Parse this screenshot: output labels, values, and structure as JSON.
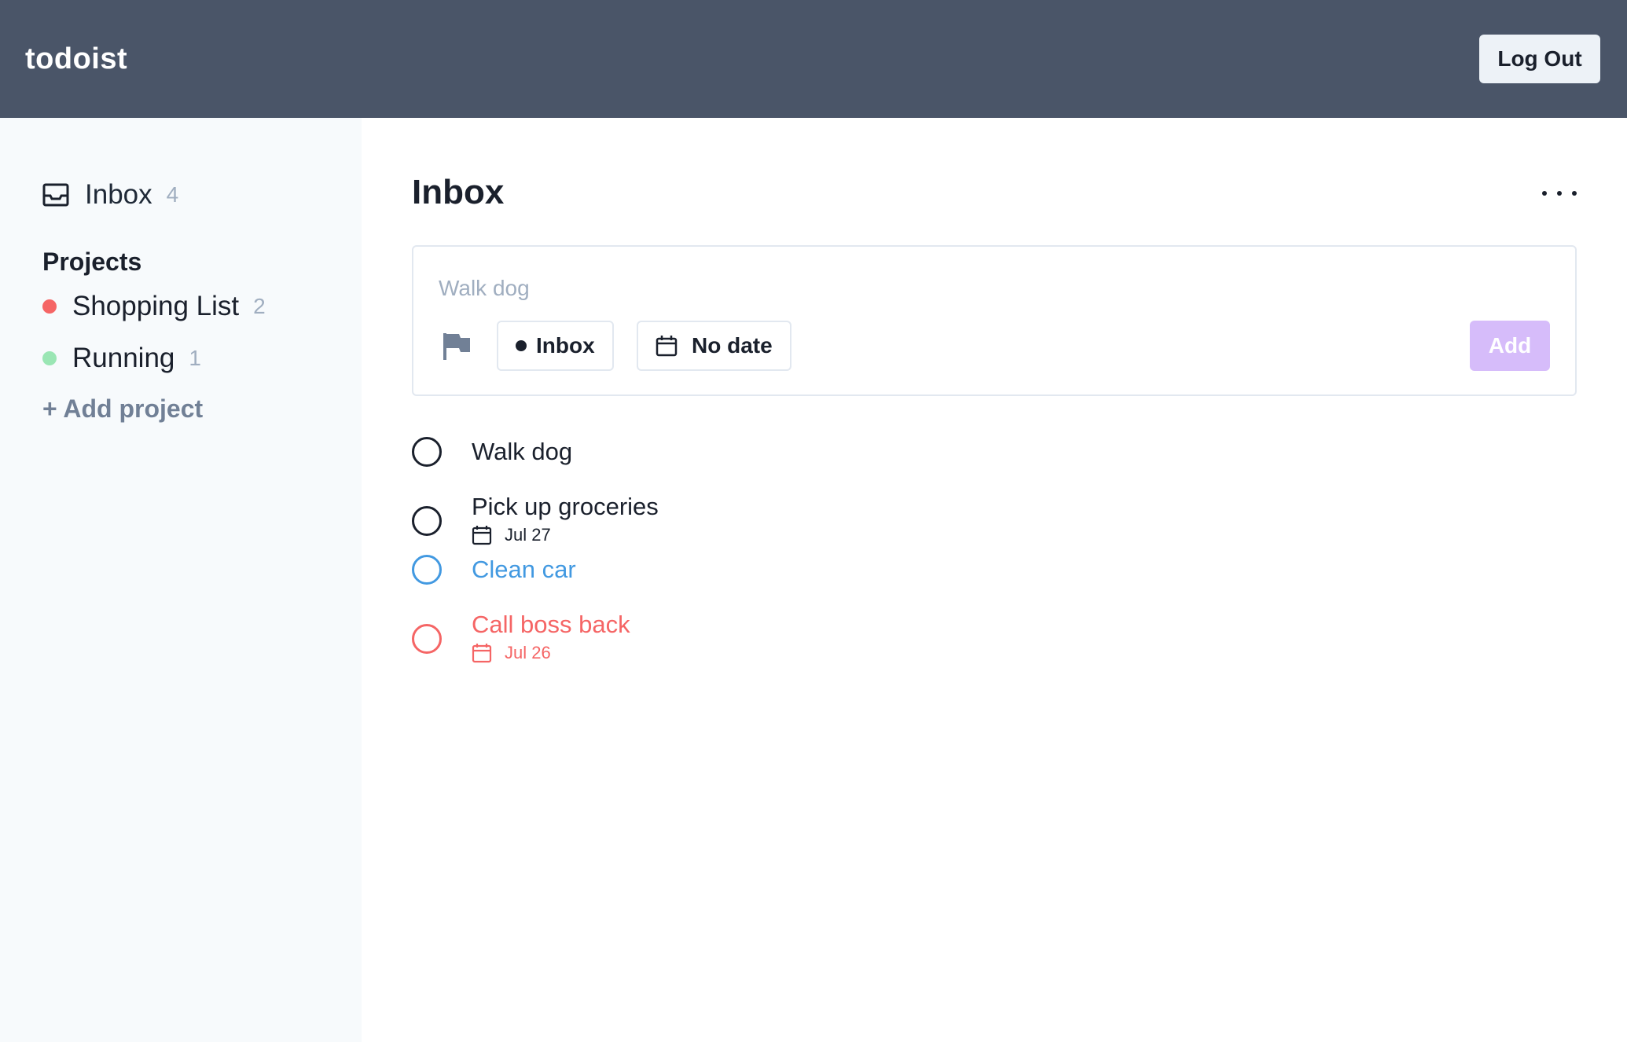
{
  "header": {
    "brand": "todoist",
    "logout_label": "Log Out"
  },
  "sidebar": {
    "inbox": {
      "label": "Inbox",
      "count": "4"
    },
    "projects_heading": "Projects",
    "projects": [
      {
        "name": "Shopping List",
        "count": "2",
        "color": "#f56565"
      },
      {
        "name": "Running",
        "count": "1",
        "color": "#9ae6b4"
      }
    ],
    "add_project_label": "+ Add project"
  },
  "main": {
    "title": "Inbox",
    "composer": {
      "placeholder": "Walk dog",
      "project_chip": "Inbox",
      "date_chip": "No date",
      "add_label": "Add"
    },
    "tasks": [
      {
        "title": "Walk dog",
        "due": "",
        "color": "#1a202c"
      },
      {
        "title": "Pick up groceries",
        "due": "Jul 27",
        "color": "#1a202c"
      },
      {
        "title": "Clean car",
        "due": "",
        "color": "#4299e1"
      },
      {
        "title": "Call boss back",
        "due": "Jul 26",
        "color": "#f56565"
      }
    ]
  },
  "colors": {
    "header_bg": "#4a5568",
    "accent": "#d6bcfa",
    "sidebar_bg": "#f7fafc"
  }
}
